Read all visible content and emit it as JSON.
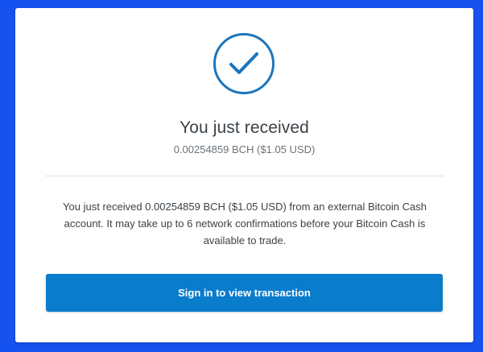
{
  "colors": {
    "page_background": "#1652f0",
    "accent": "#0a7ccc",
    "check_stroke": "#1b75bc"
  },
  "status_icon": "checkmark-circle-icon",
  "title": "You just received",
  "amount": "0.00254859 BCH ($1.05 USD)",
  "message": "You just received 0.00254859 BCH ($1.05 USD) from an external Bitcoin Cash account. It may take up to 6 network confirmations before your Bitcoin Cash is available to trade.",
  "cta_label": "Sign in to view transaction"
}
